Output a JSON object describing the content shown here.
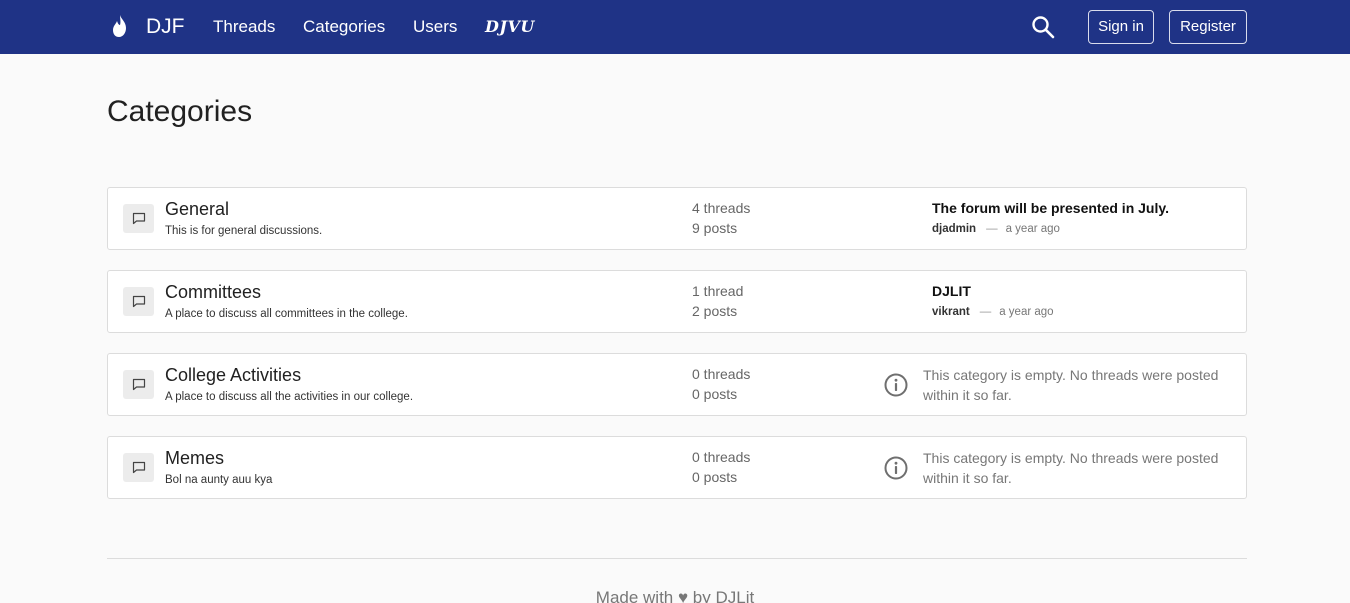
{
  "nav": {
    "brand": "DJF",
    "links": [
      "Threads",
      "Categories",
      "Users"
    ],
    "special": "DJVU",
    "sign_in": "Sign in",
    "register": "Register"
  },
  "page": {
    "title": "Categories"
  },
  "categories": [
    {
      "name": "General",
      "description": "This is for general discussions.",
      "threads": "4 threads",
      "posts": "9 posts",
      "last_thread_title": "The forum will be presented in July.",
      "last_author": "djadmin",
      "separator": "—",
      "last_time": "a year ago"
    },
    {
      "name": "Committees",
      "description": "A place to discuss all committees in the college.",
      "threads": "1 thread",
      "posts": "2 posts",
      "last_thread_title": "DJLIT",
      "last_author": "vikrant",
      "separator": "—",
      "last_time": "a year ago"
    },
    {
      "name": "College Activities",
      "description": "A place to discuss all the activities in our college.",
      "threads": "0 threads",
      "posts": "0 posts",
      "empty_message": "This category is empty. No threads were posted within it so far."
    },
    {
      "name": "Memes",
      "description": "Bol na aunty auu kya",
      "threads": "0 threads",
      "posts": "0 posts",
      "empty_message": "This category is empty. No threads were posted within it so far."
    }
  ],
  "footer": {
    "text": "Made with ♥ by DJLit"
  },
  "colors": {
    "navbar": "#1f3386",
    "background": "#fafafa",
    "card_border": "#dcdcdc"
  },
  "icons": [
    "flame-logo-icon",
    "search-icon",
    "chat-bubble-icon",
    "info-icon"
  ]
}
